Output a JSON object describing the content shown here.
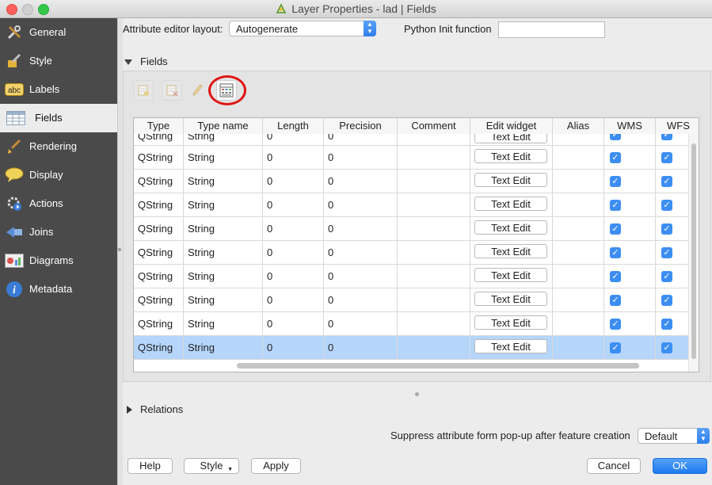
{
  "window": {
    "title": "Layer Properties - lad | Fields"
  },
  "sidebar": {
    "items": [
      {
        "label": "General",
        "icon": "tools-icon"
      },
      {
        "label": "Style",
        "icon": "paint-icon"
      },
      {
        "label": "Labels",
        "icon": "abc-label-icon"
      },
      {
        "label": "Fields",
        "icon": "table-icon"
      },
      {
        "label": "Rendering",
        "icon": "brush-icon"
      },
      {
        "label": "Display",
        "icon": "speech-bubble-icon"
      },
      {
        "label": "Actions",
        "icon": "gear-play-icon"
      },
      {
        "label": "Joins",
        "icon": "join-icon"
      },
      {
        "label": "Diagrams",
        "icon": "diagram-icon"
      },
      {
        "label": "Metadata",
        "icon": "info-icon"
      }
    ],
    "active": "Fields"
  },
  "top": {
    "layout_label": "Attribute editor layout:",
    "layout_value": "Autogenerate",
    "python_label": "Python Init function",
    "python_value": ""
  },
  "fields_section": {
    "title": "Fields",
    "columns": [
      "Type",
      "Type name",
      "Length",
      "Precision",
      "Comment",
      "Edit widget",
      "Alias",
      "WMS",
      "WFS"
    ],
    "partial_row": {
      "type": "QString",
      "type_name": "String",
      "length": "0",
      "precision": "0",
      "widget": "Text Edit"
    },
    "rows": [
      {
        "type": "QString",
        "type_name": "String",
        "length": "0",
        "precision": "0",
        "comment": "",
        "widget": "Text Edit",
        "alias": "",
        "wms": true,
        "wfs": true
      },
      {
        "type": "QString",
        "type_name": "String",
        "length": "0",
        "precision": "0",
        "comment": "",
        "widget": "Text Edit",
        "alias": "",
        "wms": true,
        "wfs": true
      },
      {
        "type": "QString",
        "type_name": "String",
        "length": "0",
        "precision": "0",
        "comment": "",
        "widget": "Text Edit",
        "alias": "",
        "wms": true,
        "wfs": true
      },
      {
        "type": "QString",
        "type_name": "String",
        "length": "0",
        "precision": "0",
        "comment": "",
        "widget": "Text Edit",
        "alias": "",
        "wms": true,
        "wfs": true
      },
      {
        "type": "QString",
        "type_name": "String",
        "length": "0",
        "precision": "0",
        "comment": "",
        "widget": "Text Edit",
        "alias": "",
        "wms": true,
        "wfs": true
      },
      {
        "type": "QString",
        "type_name": "String",
        "length": "0",
        "precision": "0",
        "comment": "",
        "widget": "Text Edit",
        "alias": "",
        "wms": true,
        "wfs": true
      },
      {
        "type": "QString",
        "type_name": "String",
        "length": "0",
        "precision": "0",
        "comment": "",
        "widget": "Text Edit",
        "alias": "",
        "wms": true,
        "wfs": true
      },
      {
        "type": "QString",
        "type_name": "String",
        "length": "0",
        "precision": "0",
        "comment": "",
        "widget": "Text Edit",
        "alias": "",
        "wms": true,
        "wfs": true
      },
      {
        "type": "QString",
        "type_name": "String",
        "length": "0",
        "precision": "0",
        "comment": "",
        "widget": "Text Edit",
        "alias": "",
        "wms": true,
        "wfs": true
      }
    ],
    "toolbar": [
      "new-field-icon",
      "delete-field-icon",
      "toggle-editing-icon",
      "field-calculator-icon"
    ]
  },
  "relations_section": {
    "title": "Relations"
  },
  "suppress": {
    "label": "Suppress attribute form pop-up after feature creation",
    "value": "Default"
  },
  "buttons": {
    "help": "Help",
    "style": "Style",
    "apply": "Apply",
    "cancel": "Cancel",
    "ok": "OK"
  },
  "colors": {
    "accent": "#2f7fee",
    "highlight_ring": "#e01515",
    "selected_row": "#b5d5fb",
    "sidebar_bg": "#4a4a4a"
  }
}
